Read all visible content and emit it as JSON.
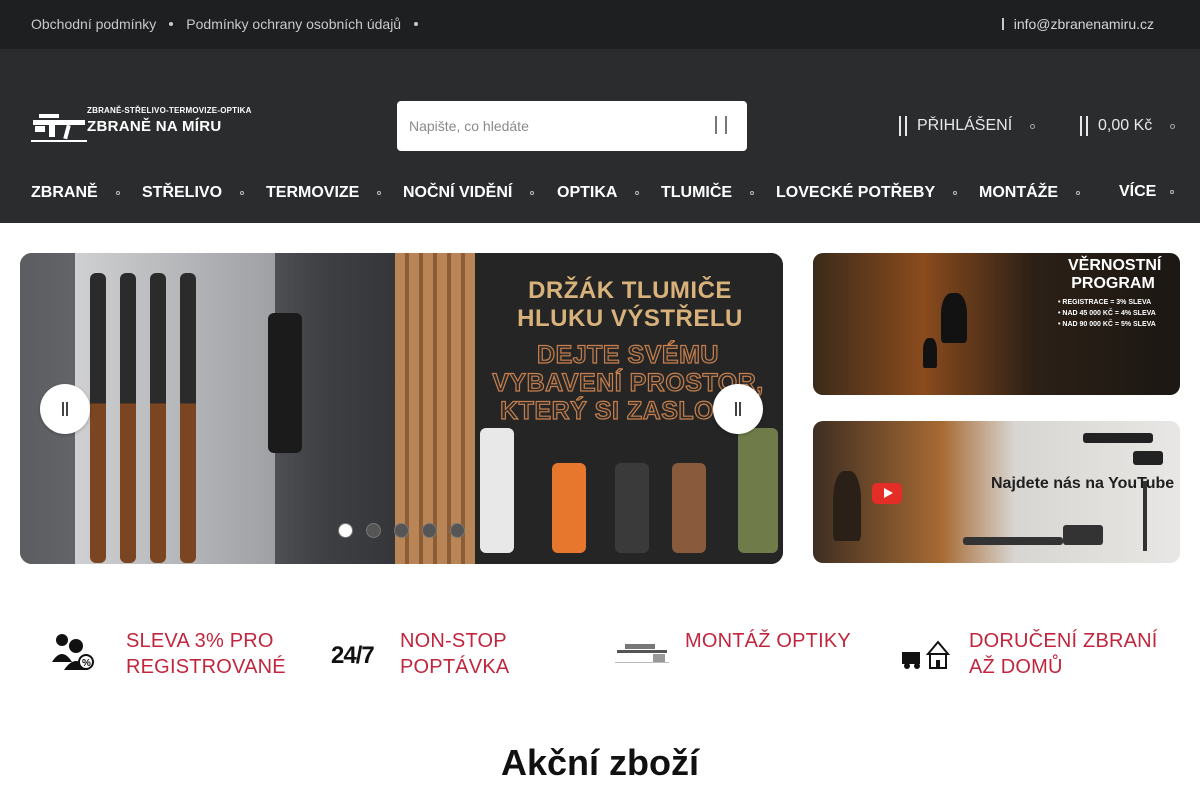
{
  "topbar": {
    "links": [
      "Obchodní podmínky",
      "Podmínky ochrany osobních údajů"
    ],
    "email": "info@zbranenamiru.cz"
  },
  "logo": {
    "tagline": "ZBRANĚ-STŘELIVO-TERMOVIZE-OPTIKA",
    "name": "ZBRANĚ NA MÍRU"
  },
  "search": {
    "placeholder": "Napište, co hledáte"
  },
  "account": {
    "login_label": "PŘIHLÁŠENÍ",
    "cart_total": "0,00 Kč"
  },
  "nav": {
    "items": [
      "ZBRANĚ",
      "STŘELIVO",
      "TERMOVIZE",
      "NOČNÍ VIDĚNÍ",
      "OPTIKA",
      "TLUMIČE",
      "LOVECKÉ POTŘEBY",
      "MONTÁŽE",
      "VÍCE"
    ]
  },
  "hero": {
    "title": "DRŽÁK TLUMIČE HLUKU VÝSTŘELU",
    "subtitle": "DEJTE SVÉMU VYBAVENÍ PROSTOR, KTERÝ SI ZASLOUŽÍ",
    "slide_count": 5,
    "active_slide": 1
  },
  "banners": {
    "loyalty_title": "VĚRNOSTNÍ PROGRAM",
    "loyalty_lines": [
      "• REGISTRACE = 3% SLEVA",
      "• NAD 45 000 KČ = 4% SLEVA",
      "• NAD 90 000 KČ = 5% SLEVA"
    ],
    "youtube_text": "Najdete nás na YouTube"
  },
  "features": [
    {
      "text": "SLEVA 3% PRO REGISTROVANÉ",
      "icon": "user-discount-icon"
    },
    {
      "text": "NON-STOP POPTÁVKA",
      "icon": "24-7-icon",
      "icon_label": "24/7"
    },
    {
      "text": "MONTÁŽ OPTIKY",
      "icon": "rifle-scope-icon"
    },
    {
      "text": "DORUČENÍ ZBRANÍ AŽ DOMŮ",
      "icon": "delivery-home-icon"
    }
  ],
  "section": {
    "title": "Akční zboží"
  },
  "colors": {
    "accent": "#c0263d",
    "header_bg": "#2a2c2d",
    "topbar_bg": "#1d1f20"
  }
}
